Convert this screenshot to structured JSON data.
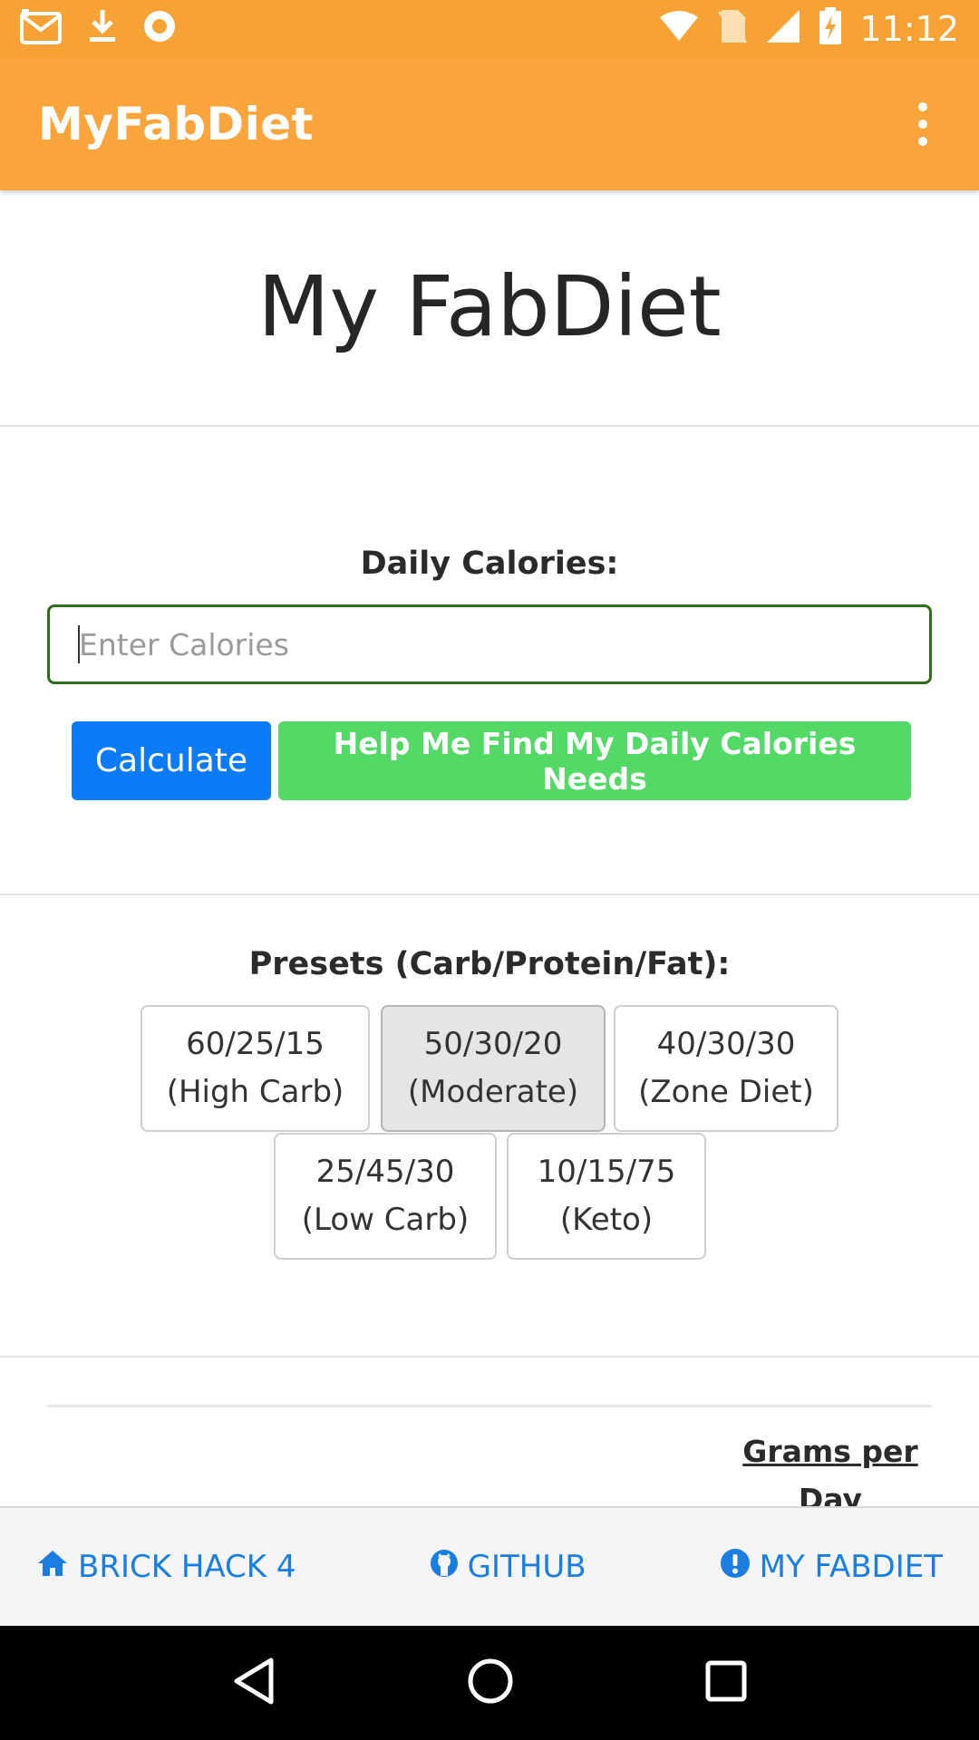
{
  "status_bar": {
    "time": "11:12",
    "left_icons": [
      "gmail-icon",
      "download-icon",
      "record-icon"
    ],
    "right_icons": [
      "wifi-icon",
      "no-sim-icon",
      "signal-icon",
      "battery-charging-icon"
    ]
  },
  "app_bar": {
    "title": "MyFabDiet",
    "menu_icon": "overflow-menu-icon"
  },
  "page": {
    "title": "My FabDiet"
  },
  "calories": {
    "label": "Daily Calories:",
    "placeholder": "Enter Calories",
    "value": "",
    "calculate_label": "Calculate",
    "help_label": "Help Me Find My Daily Calories Needs"
  },
  "presets": {
    "label": "Presets (Carb/Protein/Fat):",
    "items": [
      {
        "ratio": "60/25/15",
        "name": "(High Carb)",
        "active": false
      },
      {
        "ratio": "50/30/20",
        "name": "(Moderate)",
        "active": true
      },
      {
        "ratio": "40/30/30",
        "name": "(Zone Diet)",
        "active": false
      },
      {
        "ratio": "25/45/30",
        "name": "(Low Carb)",
        "active": false
      },
      {
        "ratio": "10/15/75",
        "name": "(Keto)",
        "active": false
      }
    ]
  },
  "table": {
    "grams_header_line1": "Grams per",
    "grams_header_line2": "Day"
  },
  "footer": {
    "links": [
      {
        "label": "BRICK HACK 4",
        "icon": "home-icon"
      },
      {
        "label": "GITHUB",
        "icon": "github-icon"
      },
      {
        "label": "MY FABDIET",
        "icon": "info-circle-icon"
      }
    ]
  },
  "nav_bar": {
    "icons": [
      "back-icon",
      "home-circle-icon",
      "recents-icon"
    ]
  },
  "colors": {
    "status_bar": "#f7a234",
    "app_bar": "#f9a53c",
    "calculate": "#0b7bf8",
    "help": "#52d966",
    "link": "#1a7ee0"
  }
}
